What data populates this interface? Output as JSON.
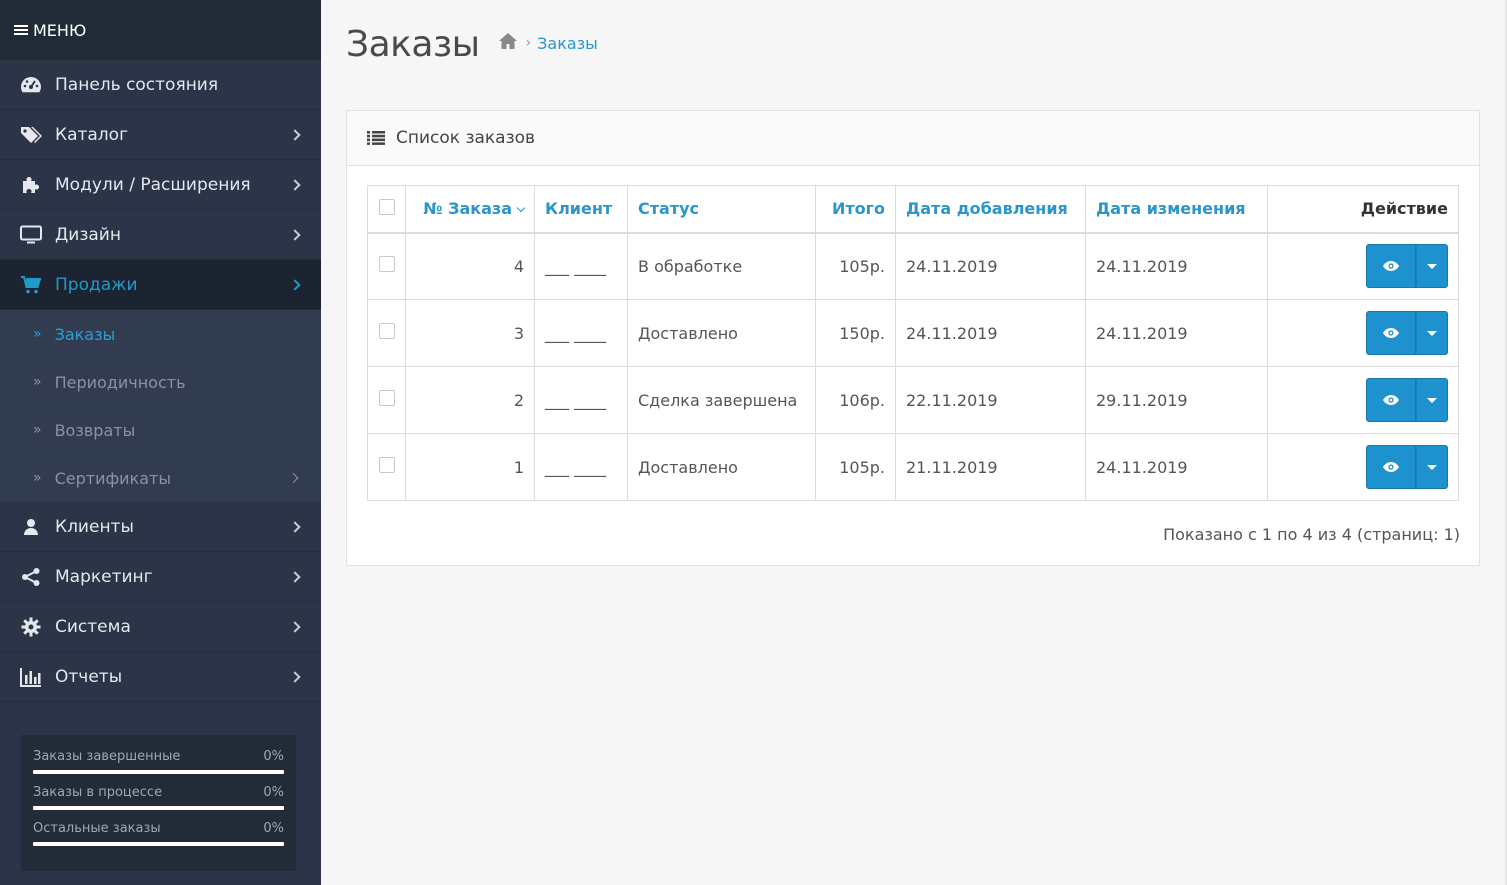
{
  "sidebar": {
    "menu_label": "МЕНЮ",
    "items": [
      {
        "label": "Панель состояния"
      },
      {
        "label": "Каталог"
      },
      {
        "label": "Модули / Расширения"
      },
      {
        "label": "Дизайн"
      },
      {
        "label": "Продажи"
      },
      {
        "label": "Клиенты"
      },
      {
        "label": "Маркетинг"
      },
      {
        "label": "Система"
      },
      {
        "label": "Отчеты"
      }
    ],
    "submenu": [
      {
        "label": "Заказы"
      },
      {
        "label": "Периодичность"
      },
      {
        "label": "Возвраты"
      },
      {
        "label": "Сертификаты"
      }
    ],
    "stats": [
      {
        "label": "Заказы завершенные",
        "value": "0%"
      },
      {
        "label": "Заказы в процессе",
        "value": "0%"
      },
      {
        "label": "Остальные заказы",
        "value": "0%"
      }
    ]
  },
  "page": {
    "title": "Заказы",
    "breadcrumb": "Заказы"
  },
  "panel": {
    "title": "Список заказов",
    "columns": {
      "order_id": "№ Заказа",
      "customer": "Клиент",
      "status": "Статус",
      "total": "Итого",
      "date_added": "Дата добавления",
      "date_modified": "Дата изменения",
      "action": "Действие"
    },
    "rows": [
      {
        "order_id": "4",
        "customer": "___ ____",
        "status": "В обработке",
        "total": "105р.",
        "date_added": "24.11.2019",
        "date_modified": "24.11.2019"
      },
      {
        "order_id": "3",
        "customer": "___ ____",
        "status": "Доставлено",
        "total": "150р.",
        "date_added": "24.11.2019",
        "date_modified": "24.11.2019"
      },
      {
        "order_id": "2",
        "customer": "___ ____",
        "status": "Сделка завершена",
        "total": "106р.",
        "date_added": "22.11.2019",
        "date_modified": "29.11.2019"
      },
      {
        "order_id": "1",
        "customer": "___ ____",
        "status": "Доставлено",
        "total": "105р.",
        "date_added": "21.11.2019",
        "date_modified": "24.11.2019"
      }
    ],
    "pagination_text": "Показано с 1 по 4 из 4 (страниц: 1)"
  },
  "colors": {
    "accent": "#1e91cf",
    "sidebar_bg": "#2b3547",
    "link": "#2a96cc"
  }
}
